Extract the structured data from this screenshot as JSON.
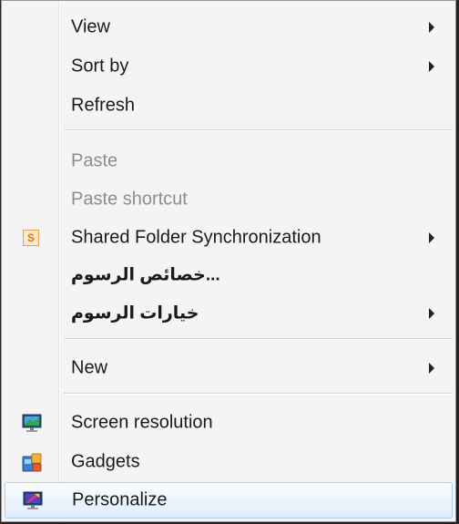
{
  "context_menu": {
    "items": [
      {
        "label": "View",
        "submenu": true,
        "enabled": true
      },
      {
        "label": "Sort by",
        "submenu": true,
        "enabled": true
      },
      {
        "label": "Refresh",
        "submenu": false,
        "enabled": true
      },
      {
        "label": "Paste",
        "submenu": false,
        "enabled": false
      },
      {
        "label": "Paste shortcut",
        "submenu": false,
        "enabled": false
      },
      {
        "label": "Shared Folder Synchronization",
        "submenu": true,
        "enabled": true,
        "icon": "shared-folder-sync-icon",
        "icon_text": "S"
      },
      {
        "label": "...خصائص الرسوم",
        "submenu": false,
        "enabled": true
      },
      {
        "label": "خيارات الرسوم",
        "submenu": true,
        "enabled": true
      },
      {
        "label": "New",
        "submenu": true,
        "enabled": true
      },
      {
        "label": "Screen resolution",
        "submenu": false,
        "enabled": true,
        "icon": "screen-resolution-icon"
      },
      {
        "label": "Gadgets",
        "submenu": false,
        "enabled": true,
        "icon": "gadgets-icon"
      },
      {
        "label": "Personalize",
        "submenu": false,
        "enabled": true,
        "icon": "personalize-icon",
        "highlighted": true
      }
    ]
  },
  "colors": {
    "menu_background": "#f4f4f4",
    "disabled_text": "#8d8d8d",
    "highlight_border": "#a9cdef"
  }
}
